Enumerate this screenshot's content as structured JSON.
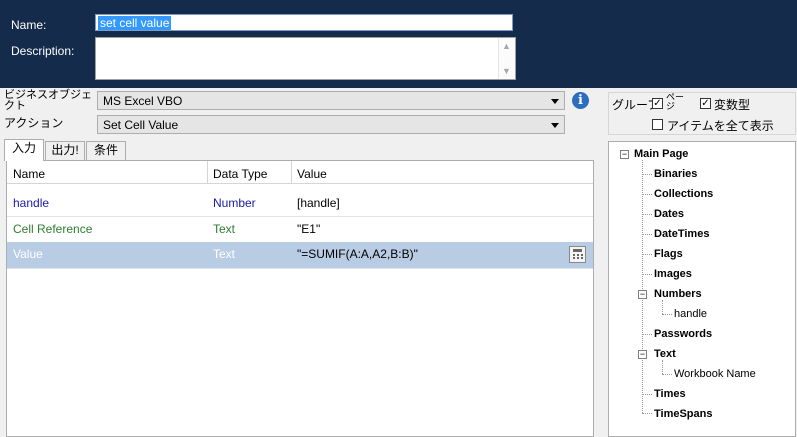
{
  "header": {
    "name_label": "Name:",
    "name_value": "set cell value",
    "description_label": "Description:",
    "description_value": ""
  },
  "object_row": {
    "label": "ビジネスオブジェクト",
    "value": "MS Excel VBO"
  },
  "action_row": {
    "label": "アクション",
    "value": "Set Cell Value"
  },
  "tabs": [
    {
      "label": "入力"
    },
    {
      "label": "出力!"
    },
    {
      "label": "条件"
    }
  ],
  "grid": {
    "columns": [
      "Name",
      "Data Type",
      "Value"
    ],
    "rows": [
      {
        "name": "handle",
        "type": "Number",
        "value": "[handle]"
      },
      {
        "name": "Cell Reference",
        "type": "Text",
        "value": "\"E1\""
      },
      {
        "name": "Value",
        "type": "Text",
        "value": "\"=SUMIF(A:A,A2,B:B)\""
      }
    ]
  },
  "options": {
    "group_label": "グループ",
    "page_label": "ページ",
    "var_type_label": "変数型",
    "show_all_label": "アイテムを全て表示"
  },
  "tree": {
    "root": "Main Page",
    "items": [
      "Binaries",
      "Collections",
      "Dates",
      "DateTimes",
      "Flags",
      "Images",
      "Numbers",
      "Passwords",
      "Text",
      "Times",
      "TimeSpans"
    ],
    "numbers_child": "handle",
    "text_child": "Workbook Name"
  },
  "colors": {
    "header_bg": "#142b4b",
    "selection": "#3399ff",
    "row_selected": "#b8cce4",
    "number_blue": "#1a1aa6",
    "text_green": "#2e7d32",
    "info_blue": "#2b6dbf"
  }
}
